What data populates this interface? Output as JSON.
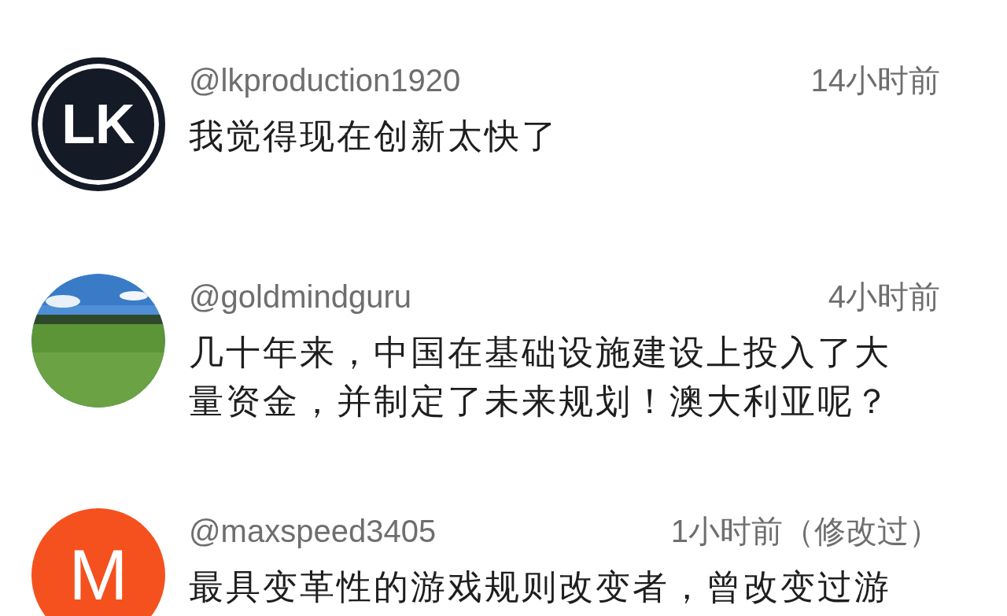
{
  "comments": [
    {
      "avatar": {
        "kind": "logo",
        "text": "LK"
      },
      "username": "@lkproduction1920",
      "time": "14小时前",
      "text": "我觉得现在创新太快了"
    },
    {
      "username": "@goldmindguru",
      "time": "4小时前",
      "text": "几十年来，中国在基础设施建设上投入了大量资金，并制定了未来规划！澳大利亚呢？"
    },
    {
      "avatar": {
        "kind": "letter",
        "text": "M"
      },
      "username": "@maxspeed3405",
      "time": "1小时前（修改过）",
      "text": "最具变革性的游戏规则改变者，曾改变过游"
    }
  ]
}
